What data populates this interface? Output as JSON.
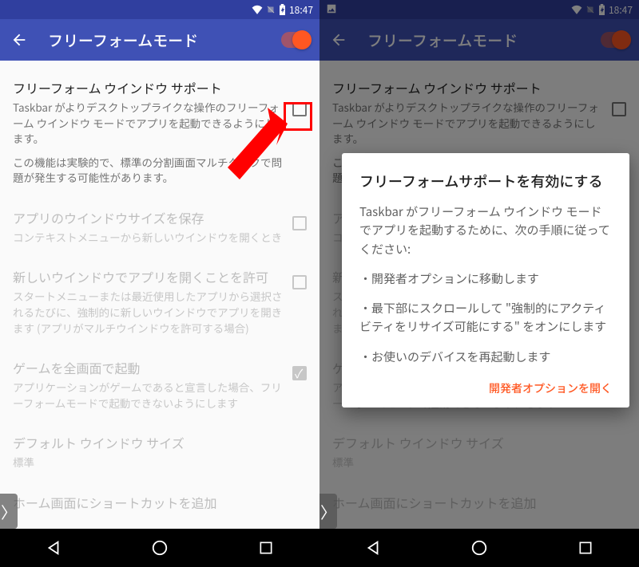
{
  "status": {
    "time": "18:47"
  },
  "appbar": {
    "title": "フリーフォームモード"
  },
  "settings": {
    "s1": {
      "title": "フリーフォーム ウインドウ サポート",
      "sub": "Taskbar がよりデスクトップライクな操作のフリーフォーム ウインドウ モードでアプリを起動できるようにします。",
      "sub2": "この機能は実験的で、標準の分割画面マルチタスクで問題が発生する可能性があります。"
    },
    "s2": {
      "title": "アプリのウインドウサイズを保存",
      "sub": "コンテキストメニューから新しいウインドウを開くとき"
    },
    "s3": {
      "title": "新しいウインドウでアプリを開くことを許可",
      "sub": "スタートメニューまたは最近使用したアプリから選択されるたびに、強制的に新しいウインドウでアプリを開きます (アプリがマルチウインドウを許可する場合)"
    },
    "s4": {
      "title": "ゲームを全画面で起動",
      "sub": "アプリケーションがゲームであると宣言した場合、フリーフォームモードで起動できないようにします"
    },
    "s5": {
      "title": "デフォルト ウインドウ サイズ",
      "sub": "標準"
    },
    "s6": {
      "title": "ホーム画面にショートカットを追加"
    }
  },
  "dialog": {
    "title": "フリーフォームサポートを有効にする",
    "intro": "Taskbar がフリーフォーム ウインドウ モードでアプリを起動するために、次の手順に従ってください:",
    "step1": "・開発者オプションに移動します",
    "step2": "・最下部にスクロールして \"強制的にアクティビティをリサイズ可能にする\" をオンにします",
    "step3": "・お使いのデバイスを再起動します",
    "action": "開発者オプションを開く"
  }
}
